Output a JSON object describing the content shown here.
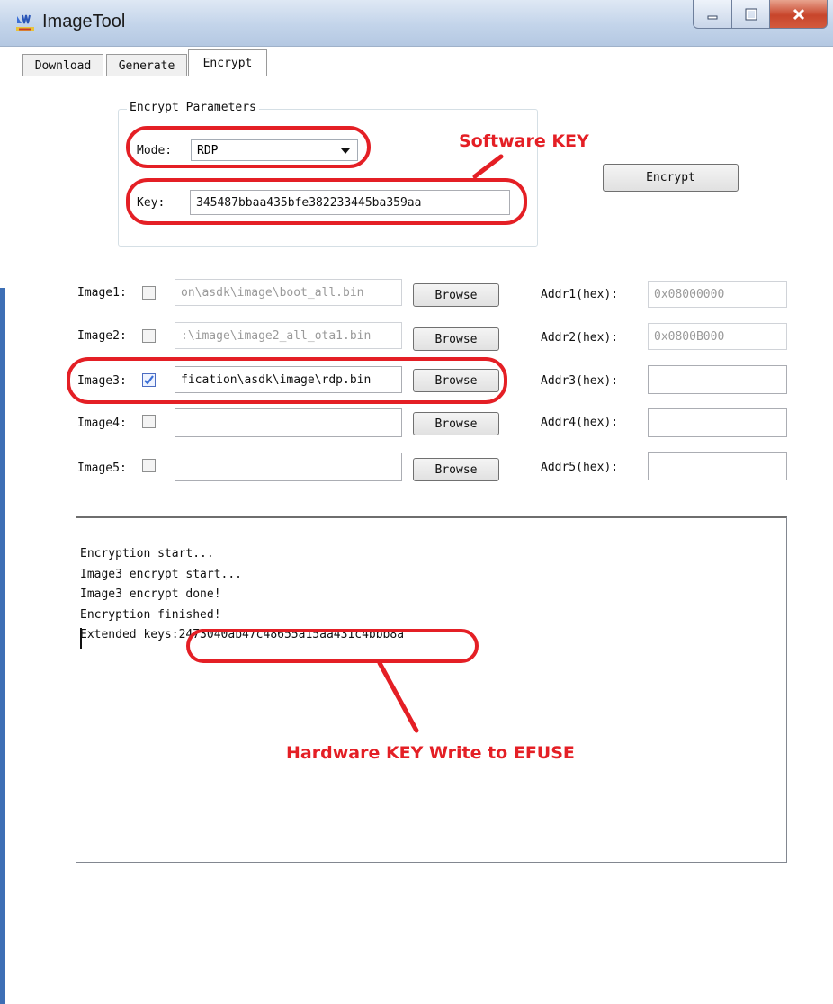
{
  "window": {
    "title": "ImageTool",
    "icon": "imagetool-logo-icon"
  },
  "tabs": [
    {
      "label": "Download",
      "active": false
    },
    {
      "label": "Generate",
      "active": false
    },
    {
      "label": "Encrypt",
      "active": true
    }
  ],
  "encrypt_params": {
    "group_title": "Encrypt Parameters",
    "mode_label": "Mode:",
    "mode_value": "RDP",
    "key_label": "Key:",
    "key_value": "345487bbaa435bfe382233445ba359aa"
  },
  "encrypt_button": "Encrypt",
  "images": [
    {
      "label": "Image1:",
      "checked": false,
      "path": "on\\asdk\\image\\boot_all.bin",
      "path_disabled": true,
      "browse": "Browse",
      "addr_label": "Addr1(hex):",
      "addr": "0x08000000",
      "addr_disabled": true
    },
    {
      "label": "Image2:",
      "checked": false,
      "path": ":\\image\\image2_all_ota1.bin",
      "path_disabled": true,
      "browse": "Browse",
      "addr_label": "Addr2(hex):",
      "addr": "0x0800B000",
      "addr_disabled": true
    },
    {
      "label": "Image3:",
      "checked": true,
      "path": "fication\\asdk\\image\\rdp.bin",
      "path_disabled": false,
      "browse": "Browse",
      "addr_label": "Addr3(hex):",
      "addr": "",
      "addr_disabled": false
    },
    {
      "label": "Image4:",
      "checked": false,
      "path": "",
      "path_disabled": false,
      "browse": "Browse",
      "addr_label": "Addr4(hex):",
      "addr": "",
      "addr_disabled": false
    },
    {
      "label": "Image5:",
      "checked": false,
      "path": "",
      "path_disabled": false,
      "browse": "Browse",
      "addr_label": "Addr5(hex):",
      "addr": "",
      "addr_disabled": false
    }
  ],
  "log": {
    "lines": [
      "Encryption start...",
      "Image3 encrypt start...",
      "Image3 encrypt done!",
      "Encryption finished!"
    ],
    "extended_prefix": "Extended keys:",
    "extended_value": "2473040ab47c48655a15aa431c4bbb8a"
  },
  "annotations": {
    "software_key": "Software KEY",
    "hardware_key": "Hardware KEY Write to EFUSE",
    "color": "#e41f25"
  },
  "colors": {
    "title_bar": "#c3d4ea",
    "close_button": "#c8452b",
    "checkbox_check": "#3b6fd6"
  }
}
